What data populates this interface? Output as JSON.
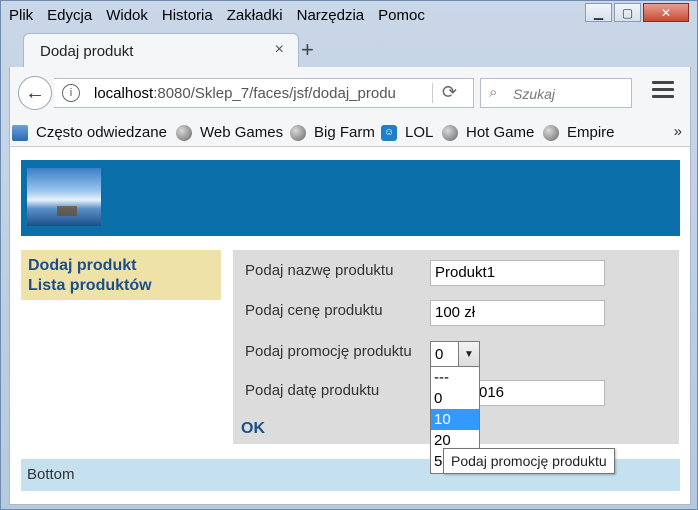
{
  "window": {
    "menu": [
      "Plik",
      "Edycja",
      "Widok",
      "Historia",
      "Zakładki",
      "Narzędzia",
      "Pomoc"
    ],
    "controls": {
      "minimize": "▁",
      "maximize": "▢",
      "close": "✕"
    }
  },
  "tabs": {
    "active_title": "Dodaj produkt",
    "close_glyph": "×",
    "new_tab_glyph": "+"
  },
  "nav": {
    "back_glyph": "←",
    "info_glyph": "i",
    "url_host": "localhost",
    "url_rest": ":8080/Sklep_7/faces/jsf/dodaj_produ",
    "reload_glyph": "⟳",
    "search_glyph": "⌕",
    "search_placeholder": "Szukaj"
  },
  "bookmarks": {
    "items": [
      "Często odwiedzane",
      "Web Games",
      "Big Farm",
      "LOL",
      "Hot Game",
      "Empire"
    ],
    "more_glyph": "»",
    "lol_icon_glyph": "☺"
  },
  "sidebar": {
    "links": [
      "Dodaj produkt",
      "Lista produktów"
    ]
  },
  "form": {
    "name_label": "Podaj nazwę produktu",
    "name_value": "Produkt1",
    "price_label": "Podaj cenę produktu",
    "price_value": "100 zł",
    "promo_label": "Podaj promocję produktu",
    "promo_value": "0",
    "promo_arrow": "▼",
    "date_label": "Podaj datę produktu",
    "date_value_visible": "016",
    "ok_label": "OK",
    "promo_options": [
      "---",
      "0",
      "10",
      "20",
      "5"
    ],
    "promo_highlighted_index": 2,
    "tooltip": "Podaj promocję produktu"
  },
  "footer": {
    "text": "Bottom"
  }
}
